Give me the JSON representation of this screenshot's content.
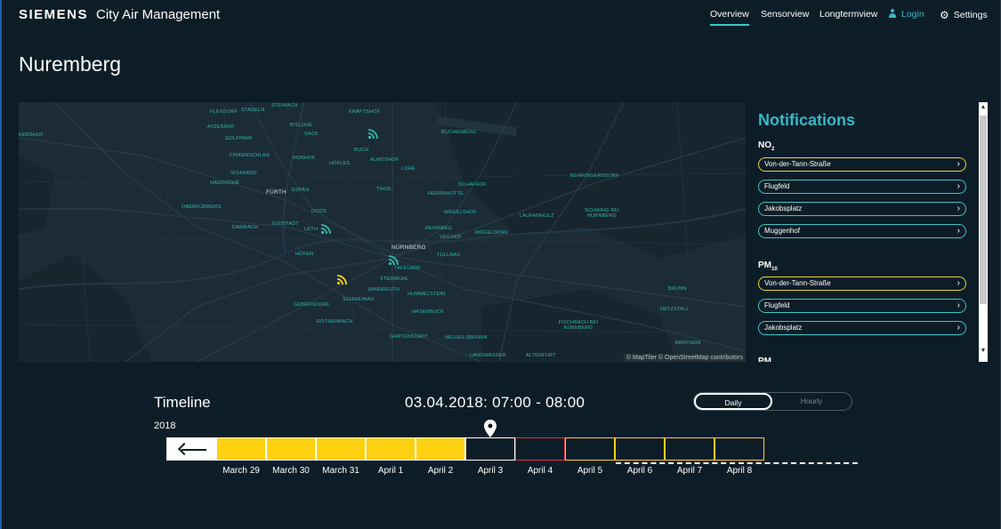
{
  "header": {
    "brand": "SIEMENS",
    "app_title": "City Air Management",
    "nav": {
      "overview": "Overview",
      "sensorview": "Sensorview",
      "longtermview": "Longtermview",
      "login": "Login",
      "settings": "Settings"
    },
    "active_nav": "overview"
  },
  "page_title": "Nuremberg",
  "map": {
    "attribution": "© MapTiler © OpenStreetMap contributors",
    "labels": {
      "kerhof": "KERSHOF",
      "flexdorf": "FLEXDORF",
      "stadeln": "STADELN",
      "steinach": "STEINACH",
      "kraftshof": "KRAFTSHOF",
      "atzenhof": "ATZENHOF",
      "bislohe": "BISLOHE",
      "sack": "SACK",
      "golfpark": "GOLFPARK",
      "buchenbuhl": "BUCHENBÜHL",
      "finkenschlag": "FINKENSCHLAG",
      "ronhof": "RONHOF",
      "buch": "BUCH",
      "almoshof": "ALMOSHOF",
      "hofles": "HÖFLES",
      "lohe": "LOHE",
      "schwand": "SCHWAND",
      "hardhohe": "HARDHÖHE",
      "fuerth": "FÜRTH",
      "espan": "ESPAN",
      "thon": "THON",
      "herrnhutte": "HERRNHÜTTE",
      "schafhof": "SCHAFHOF",
      "behringersdorf": "BEHRINGERSDORF",
      "oberfurberg": "OBERFÜRBERG",
      "doos": "DOOS",
      "wegelshof": "WEGELSHOF",
      "laufamholz": "LAUFAMHOLZ",
      "schwaig": "SCHWAIG BEI NÜRNBERG",
      "dambach": "DAMBACH",
      "sudstadt": "SÜDSTADT",
      "leyh": "LEYH",
      "rennweg": "RENNWEG",
      "veilhof": "VEILHOF",
      "mogeldorf": "MÖGELDORF",
      "nuernberg": "NÜRNBERG",
      "hofen": "HÖFEN",
      "tullnau": "TULLNAU",
      "tafelhof": "TAFELHOF",
      "steinbuhl": "STEINBÜHL",
      "sandreuth": "SANDREUTH",
      "brunn": "BRUNN",
      "hummelstein": "HUMMELSTEIN",
      "gebersdorf": "GEBERSDORF",
      "schweinau": "SCHWEINAU",
      "hasenbuck": "HASENBUCK",
      "netzstall": "NETZSTALL",
      "rothenbach": "RÖTHENBACH",
      "fischbach": "FISCHBACH BEI NÜRNBERG",
      "gartenstadt": "GARTENSTADT",
      "neuselsbrunn": "NEUSELSBRUNN",
      "brnthon": "BRNTHON",
      "langwasser": "LANGWASSER",
      "altenfurt": "ALTENFURT"
    }
  },
  "notifications": {
    "title": "Notifications",
    "no2": {
      "label": "NO",
      "sub": "2",
      "items": [
        "Von-der-Tann-Straße",
        "Flugfeld",
        "Jakobsplatz",
        "Muggenhof"
      ]
    },
    "pm10": {
      "label": "PM",
      "sub": "10",
      "items": [
        "Von-der-Tann-Straße",
        "Flugfeld",
        "Jakobsplatz"
      ]
    },
    "next_label": "PM"
  },
  "timeline": {
    "title": "Timeline",
    "year": "2018",
    "datetime": "03.04.2018: 07:00 - 08:00",
    "toggle": {
      "daily": "Daily",
      "hourly": "Hourly",
      "selected": "Daily"
    },
    "days": [
      {
        "label": "March 29",
        "status": "yellow"
      },
      {
        "label": "March 30",
        "status": "yellow"
      },
      {
        "label": "March 31",
        "status": "yellow"
      },
      {
        "label": "April 1",
        "status": "yellow"
      },
      {
        "label": "April 2",
        "status": "yellow"
      },
      {
        "label": "April 3",
        "status": "selected"
      },
      {
        "label": "April 4",
        "status": "red-outline"
      },
      {
        "label": "April 5",
        "status": "yellow-outline"
      },
      {
        "label": "April 6",
        "status": "yellow-outline"
      },
      {
        "label": "April 7",
        "status": "yellow-outline"
      },
      {
        "label": "April 8",
        "status": "yellow-outline"
      }
    ]
  },
  "colors": {
    "accent": "#35b9c6",
    "yellow": "#ffd00f",
    "red": "#d8343c",
    "background": "#0d1d27"
  }
}
